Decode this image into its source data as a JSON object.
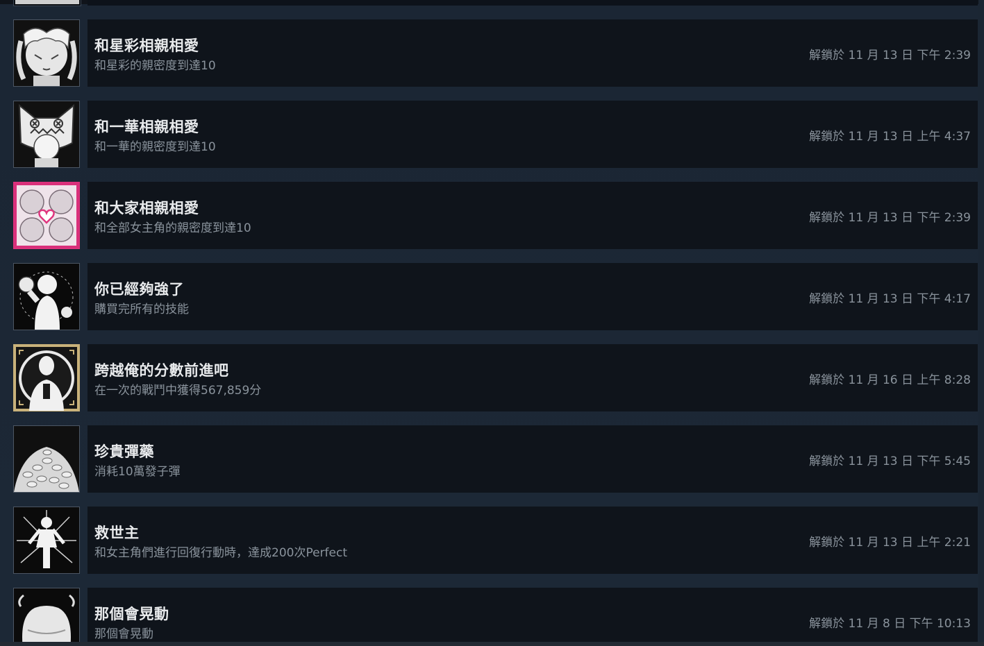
{
  "colors": {
    "page_bg": "#1b2838",
    "row_bg": "#0f141b",
    "title": "#e8eaec",
    "muted": "#8a939c",
    "pink_accent": "#e0357f",
    "gold_accent": "#c9b27a"
  },
  "achievements": [
    {
      "title": "和星彩相親相愛",
      "description": "和星彩的親密度到達10",
      "unlock": "解鎖於 11 月 13 日 下午 2:39",
      "icon": "girl-twin-tails-icon"
    },
    {
      "title": "和一華相親相愛",
      "description": "和一華的親密度到達10",
      "unlock": "解鎖於 11 月 13 日 上午 4:37",
      "icon": "girl-cat-hood-icon"
    },
    {
      "title": "和大家相親相愛",
      "description": "和全部女主角的親密度到達10",
      "unlock": "解鎖於 11 月 13 日 下午 2:39",
      "icon": "heroines-heart-icon"
    },
    {
      "title": "你已經夠強了",
      "description": "購買完所有的技能",
      "unlock": "解鎖於 11 月 13 日 下午 4:17",
      "icon": "fist-figure-icon"
    },
    {
      "title": "跨越俺的分數前進吧",
      "description": "在一次的戰鬥中獲得567,859分",
      "unlock": "解鎖於 11 月 16 日 上午 8:28",
      "icon": "target-silhouette-icon"
    },
    {
      "title": "珍貴彈藥",
      "description": "消耗10萬發子彈",
      "unlock": "解鎖於 11 月 13 日 下午 5:45",
      "icon": "bullet-pile-icon"
    },
    {
      "title": "救世主",
      "description": "和女主角們進行回復行動時，達成200次Perfect",
      "unlock": "解鎖於 11 月 13 日 上午 2:21",
      "icon": "savior-silhouette-icon"
    },
    {
      "title": "那個會晃動",
      "description": "那個會晃動",
      "unlock": "解鎖於 11 月 8 日 下午 10:13",
      "icon": "bouncing-chest-icon"
    }
  ]
}
